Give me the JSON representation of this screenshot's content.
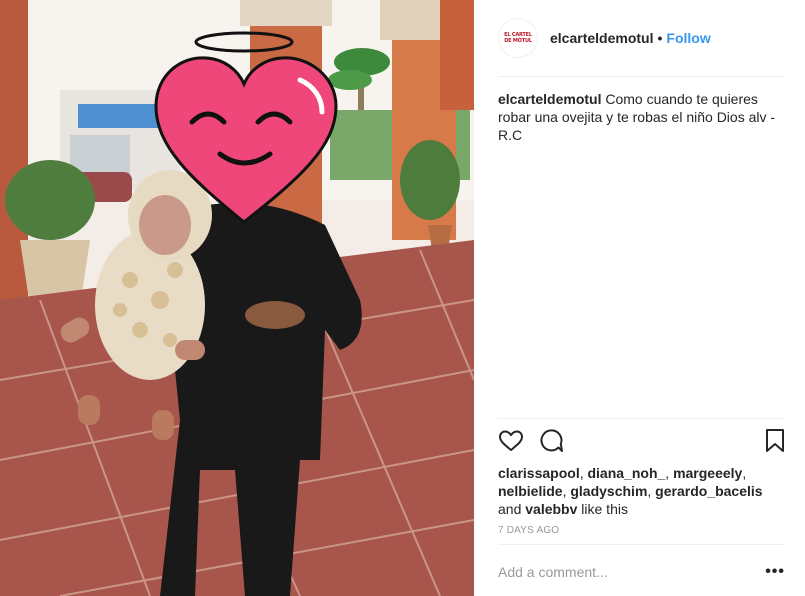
{
  "header": {
    "avatar_text": [
      "EL CARTEL",
      "DE MOTUL"
    ],
    "username": "elcarteldemotul",
    "separator": "•",
    "follow_label": "Follow"
  },
  "caption": {
    "username": "elcarteldemotul",
    "text": " Como cuando te quieres robar una ovejita y te robas el niño Dios alv - R.C"
  },
  "actions": {
    "like_icon": "heart-outline-icon",
    "comment_icon": "speech-bubble-icon",
    "save_icon": "bookmark-icon"
  },
  "likes": {
    "users": [
      "clarissapool",
      "diana_noh_",
      "margeeely",
      "nelbielide",
      "gladyschim",
      "gerardo_bacelis",
      "valebbv"
    ],
    "sep": ", ",
    "and": " and ",
    "suffix": " like this"
  },
  "timestamp": "7 DAYS AGO",
  "comment": {
    "placeholder": "Add a comment...",
    "more_label": "•••"
  },
  "photo": {
    "overlay": "heart-face-emoji-sticker",
    "halo": "halo-outline"
  },
  "colors": {
    "follow": "#3897f0",
    "heart_sticker": "#f0477b",
    "muted": "#999999"
  }
}
